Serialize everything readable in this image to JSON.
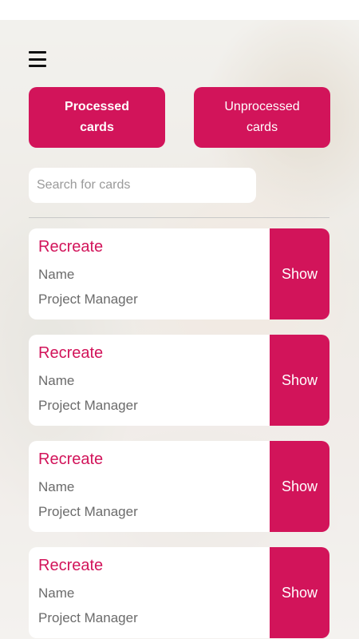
{
  "colors": {
    "accent": "#d2145a",
    "card_background": "#ffffff",
    "secondary_text": "#6b6b6b"
  },
  "header": {
    "menu_icon": "hamburger-icon"
  },
  "tabs": {
    "processed_label": "Processed cards",
    "unprocessed_label": "Unprocessed cards",
    "active": "processed"
  },
  "search": {
    "placeholder": "Search for cards",
    "value": ""
  },
  "cards": [
    {
      "title": "Recreate",
      "name": "Name",
      "role": "Project Manager",
      "action": "Show"
    },
    {
      "title": "Recreate",
      "name": "Name",
      "role": "Project Manager",
      "action": "Show"
    },
    {
      "title": "Recreate",
      "name": "Name",
      "role": "Project Manager",
      "action": "Show"
    },
    {
      "title": "Recreate",
      "name": "Name",
      "role": "Project Manager",
      "action": "Show"
    }
  ]
}
